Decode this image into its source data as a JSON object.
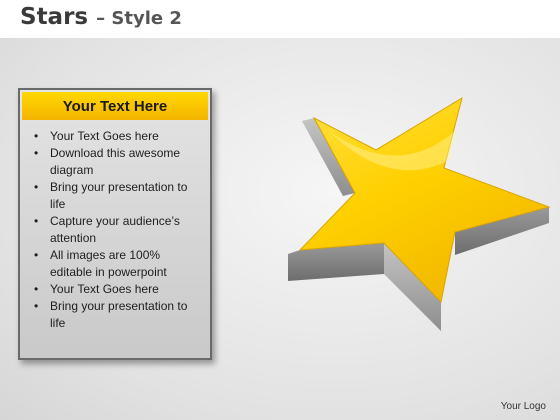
{
  "title": {
    "main": "Stars",
    "sub": "– Style 2"
  },
  "textbox": {
    "heading": "Your Text Here",
    "bullets": [
      "Your Text Goes here",
      "Download this awesome diagram",
      "Bring your presentation to life",
      "Capture your audience’s attention",
      "All images are 100% editable in powerpoint",
      "Your Text Goes here",
      "Bring your presentation to life"
    ]
  },
  "footer": {
    "logo": "Your Logo"
  },
  "colors": {
    "accent_yellow": "#f4b400",
    "star_yellow": "#ffcc00",
    "star_side": "#8a8a8a"
  }
}
